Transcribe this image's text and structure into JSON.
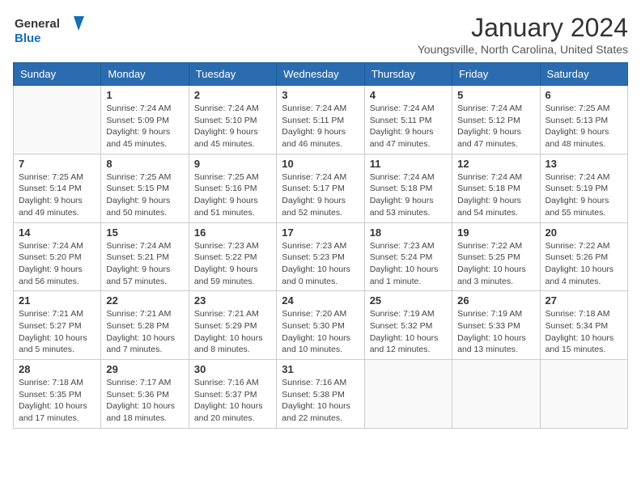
{
  "header": {
    "logo_text_general": "General",
    "logo_text_blue": "Blue",
    "month_title": "January 2024",
    "location": "Youngsville, North Carolina, United States"
  },
  "weekdays": [
    "Sunday",
    "Monday",
    "Tuesday",
    "Wednesday",
    "Thursday",
    "Friday",
    "Saturday"
  ],
  "weeks": [
    [
      {
        "day": "",
        "sunrise": "",
        "sunset": "",
        "daylight": ""
      },
      {
        "day": "1",
        "sunrise": "Sunrise: 7:24 AM",
        "sunset": "Sunset: 5:09 PM",
        "daylight": "Daylight: 9 hours and 45 minutes."
      },
      {
        "day": "2",
        "sunrise": "Sunrise: 7:24 AM",
        "sunset": "Sunset: 5:10 PM",
        "daylight": "Daylight: 9 hours and 45 minutes."
      },
      {
        "day": "3",
        "sunrise": "Sunrise: 7:24 AM",
        "sunset": "Sunset: 5:11 PM",
        "daylight": "Daylight: 9 hours and 46 minutes."
      },
      {
        "day": "4",
        "sunrise": "Sunrise: 7:24 AM",
        "sunset": "Sunset: 5:11 PM",
        "daylight": "Daylight: 9 hours and 47 minutes."
      },
      {
        "day": "5",
        "sunrise": "Sunrise: 7:24 AM",
        "sunset": "Sunset: 5:12 PM",
        "daylight": "Daylight: 9 hours and 47 minutes."
      },
      {
        "day": "6",
        "sunrise": "Sunrise: 7:25 AM",
        "sunset": "Sunset: 5:13 PM",
        "daylight": "Daylight: 9 hours and 48 minutes."
      }
    ],
    [
      {
        "day": "7",
        "sunrise": "Sunrise: 7:25 AM",
        "sunset": "Sunset: 5:14 PM",
        "daylight": "Daylight: 9 hours and 49 minutes."
      },
      {
        "day": "8",
        "sunrise": "Sunrise: 7:25 AM",
        "sunset": "Sunset: 5:15 PM",
        "daylight": "Daylight: 9 hours and 50 minutes."
      },
      {
        "day": "9",
        "sunrise": "Sunrise: 7:25 AM",
        "sunset": "Sunset: 5:16 PM",
        "daylight": "Daylight: 9 hours and 51 minutes."
      },
      {
        "day": "10",
        "sunrise": "Sunrise: 7:24 AM",
        "sunset": "Sunset: 5:17 PM",
        "daylight": "Daylight: 9 hours and 52 minutes."
      },
      {
        "day": "11",
        "sunrise": "Sunrise: 7:24 AM",
        "sunset": "Sunset: 5:18 PM",
        "daylight": "Daylight: 9 hours and 53 minutes."
      },
      {
        "day": "12",
        "sunrise": "Sunrise: 7:24 AM",
        "sunset": "Sunset: 5:18 PM",
        "daylight": "Daylight: 9 hours and 54 minutes."
      },
      {
        "day": "13",
        "sunrise": "Sunrise: 7:24 AM",
        "sunset": "Sunset: 5:19 PM",
        "daylight": "Daylight: 9 hours and 55 minutes."
      }
    ],
    [
      {
        "day": "14",
        "sunrise": "Sunrise: 7:24 AM",
        "sunset": "Sunset: 5:20 PM",
        "daylight": "Daylight: 9 hours and 56 minutes."
      },
      {
        "day": "15",
        "sunrise": "Sunrise: 7:24 AM",
        "sunset": "Sunset: 5:21 PM",
        "daylight": "Daylight: 9 hours and 57 minutes."
      },
      {
        "day": "16",
        "sunrise": "Sunrise: 7:23 AM",
        "sunset": "Sunset: 5:22 PM",
        "daylight": "Daylight: 9 hours and 59 minutes."
      },
      {
        "day": "17",
        "sunrise": "Sunrise: 7:23 AM",
        "sunset": "Sunset: 5:23 PM",
        "daylight": "Daylight: 10 hours and 0 minutes."
      },
      {
        "day": "18",
        "sunrise": "Sunrise: 7:23 AM",
        "sunset": "Sunset: 5:24 PM",
        "daylight": "Daylight: 10 hours and 1 minute."
      },
      {
        "day": "19",
        "sunrise": "Sunrise: 7:22 AM",
        "sunset": "Sunset: 5:25 PM",
        "daylight": "Daylight: 10 hours and 3 minutes."
      },
      {
        "day": "20",
        "sunrise": "Sunrise: 7:22 AM",
        "sunset": "Sunset: 5:26 PM",
        "daylight": "Daylight: 10 hours and 4 minutes."
      }
    ],
    [
      {
        "day": "21",
        "sunrise": "Sunrise: 7:21 AM",
        "sunset": "Sunset: 5:27 PM",
        "daylight": "Daylight: 10 hours and 5 minutes."
      },
      {
        "day": "22",
        "sunrise": "Sunrise: 7:21 AM",
        "sunset": "Sunset: 5:28 PM",
        "daylight": "Daylight: 10 hours and 7 minutes."
      },
      {
        "day": "23",
        "sunrise": "Sunrise: 7:21 AM",
        "sunset": "Sunset: 5:29 PM",
        "daylight": "Daylight: 10 hours and 8 minutes."
      },
      {
        "day": "24",
        "sunrise": "Sunrise: 7:20 AM",
        "sunset": "Sunset: 5:30 PM",
        "daylight": "Daylight: 10 hours and 10 minutes."
      },
      {
        "day": "25",
        "sunrise": "Sunrise: 7:19 AM",
        "sunset": "Sunset: 5:32 PM",
        "daylight": "Daylight: 10 hours and 12 minutes."
      },
      {
        "day": "26",
        "sunrise": "Sunrise: 7:19 AM",
        "sunset": "Sunset: 5:33 PM",
        "daylight": "Daylight: 10 hours and 13 minutes."
      },
      {
        "day": "27",
        "sunrise": "Sunrise: 7:18 AM",
        "sunset": "Sunset: 5:34 PM",
        "daylight": "Daylight: 10 hours and 15 minutes."
      }
    ],
    [
      {
        "day": "28",
        "sunrise": "Sunrise: 7:18 AM",
        "sunset": "Sunset: 5:35 PM",
        "daylight": "Daylight: 10 hours and 17 minutes."
      },
      {
        "day": "29",
        "sunrise": "Sunrise: 7:17 AM",
        "sunset": "Sunset: 5:36 PM",
        "daylight": "Daylight: 10 hours and 18 minutes."
      },
      {
        "day": "30",
        "sunrise": "Sunrise: 7:16 AM",
        "sunset": "Sunset: 5:37 PM",
        "daylight": "Daylight: 10 hours and 20 minutes."
      },
      {
        "day": "31",
        "sunrise": "Sunrise: 7:16 AM",
        "sunset": "Sunset: 5:38 PM",
        "daylight": "Daylight: 10 hours and 22 minutes."
      },
      {
        "day": "",
        "sunrise": "",
        "sunset": "",
        "daylight": ""
      },
      {
        "day": "",
        "sunrise": "",
        "sunset": "",
        "daylight": ""
      },
      {
        "day": "",
        "sunrise": "",
        "sunset": "",
        "daylight": ""
      }
    ]
  ]
}
